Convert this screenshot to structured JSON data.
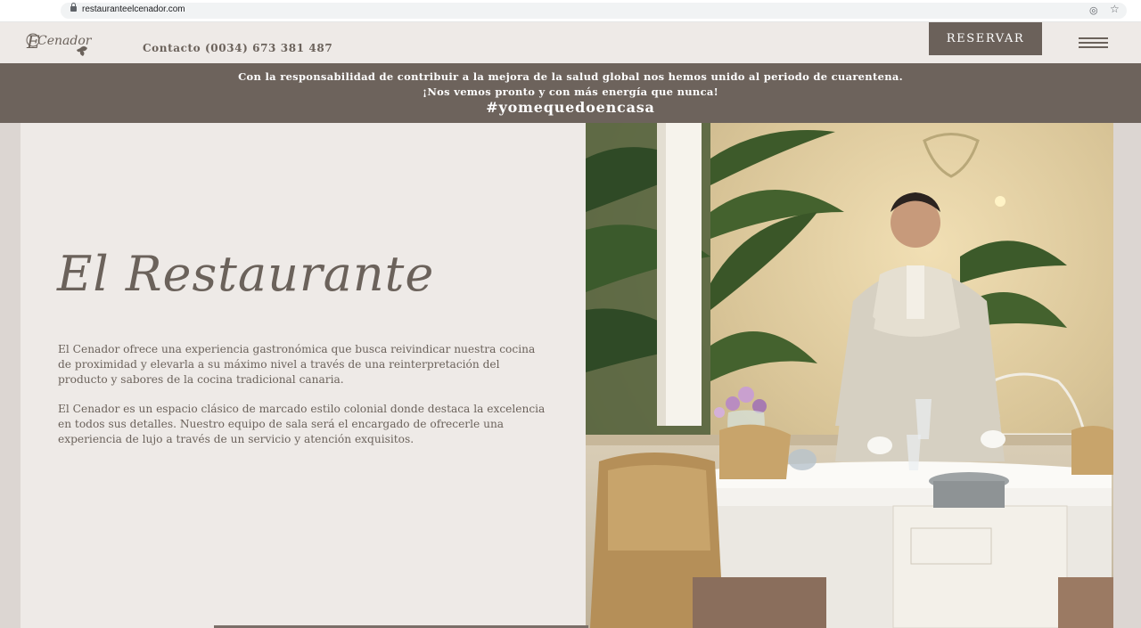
{
  "browser": {
    "url": "restauranteelcenador.com",
    "icons": [
      "lock-icon",
      "eye-off-icon",
      "star-icon"
    ]
  },
  "header": {
    "logo_text": "El Cenador",
    "contact": "Contacto (0034) 673 381 487",
    "reserve_label": "RESERVAR",
    "menu_icon": "hamburger-menu-icon"
  },
  "banner": {
    "line1": "Con la responsabilidad de contribuir a la mejora de la salud global nos hemos unido al periodo de cuarentena.",
    "line2": "¡Nos vemos pronto y con más energía que nunca!",
    "hashtag": "#yomequedoencasa"
  },
  "main": {
    "title": "El Restaurante",
    "paragraphs": [
      "El Cenador ofrece una experiencia gastronómica que busca reivindicar nuestra cocina de proximidad y elevarla a su máximo nivel a través de una reinterpretación del producto y sabores de la cocina tradicional canaria.",
      "El Cenador es un espacio clásico de marcado estilo colonial donde destaca la excelencia en todos sus detalles. Nuestro equipo de sala será el encargado de ofrecerle una experiencia de lujo a través de un servicio y atención exquisitos."
    ]
  },
  "colors": {
    "brand": "#6b625b",
    "banner_bg": "#6d635c",
    "page_bg": "#eeeae7",
    "side_bg": "#dcd6d2"
  }
}
